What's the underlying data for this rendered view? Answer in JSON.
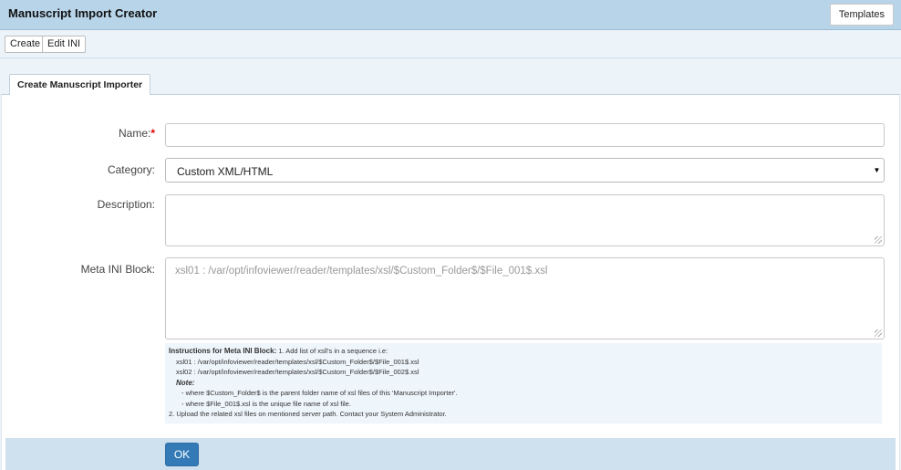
{
  "app": {
    "title": "Manuscript Import Creator"
  },
  "header": {
    "templates_label": "Templates"
  },
  "toolbar": {
    "create_label": "Create",
    "edit_ini_label": "Edit INI"
  },
  "tabs": [
    {
      "label": "Create Manuscript Importer",
      "active": true
    }
  ],
  "form": {
    "name": {
      "label": "Name:",
      "required_mark": "*",
      "value": ""
    },
    "category": {
      "label": "Category:",
      "selected": "Custom XML/HTML"
    },
    "description": {
      "label": "Description:",
      "value": ""
    },
    "meta_ini": {
      "label": "Meta INI Block:",
      "placeholder": "xsl01 : /var/opt/infoviewer/reader/templates/xsl/$Custom_Folder$/$File_001$.xsl"
    },
    "instructions": {
      "heading": "Instructions for Meta INI Block:",
      "step1": "1. Add list of xsll's in a sequence i.e:",
      "line1": "xsl01 : /var/opt/infoviewer/reader/templates/xsl/$Custom_Folder$/$File_001$.xsl",
      "line2": "xsl02 : /var/opt/infoviewer/reader/templates/xsl/$Custom_Folder$/$File_002$.xsl",
      "note_label": "Note:",
      "note1": "- where $Custom_Folder$ is the parent folder name of xsl files of this 'Manuscript Importer'.",
      "note2": "- where $File_001$.xsl is the unique file name of xsl file.",
      "step2": "2. Upload the related xsl files on mentioned server path. Contact your System Administrator."
    }
  },
  "footer": {
    "ok_label": "OK"
  },
  "colors": {
    "header_bg": "#b8d4e9",
    "panel_bg": "#ecf3f9",
    "primary": "#337ab7",
    "required": "#dd0000"
  }
}
